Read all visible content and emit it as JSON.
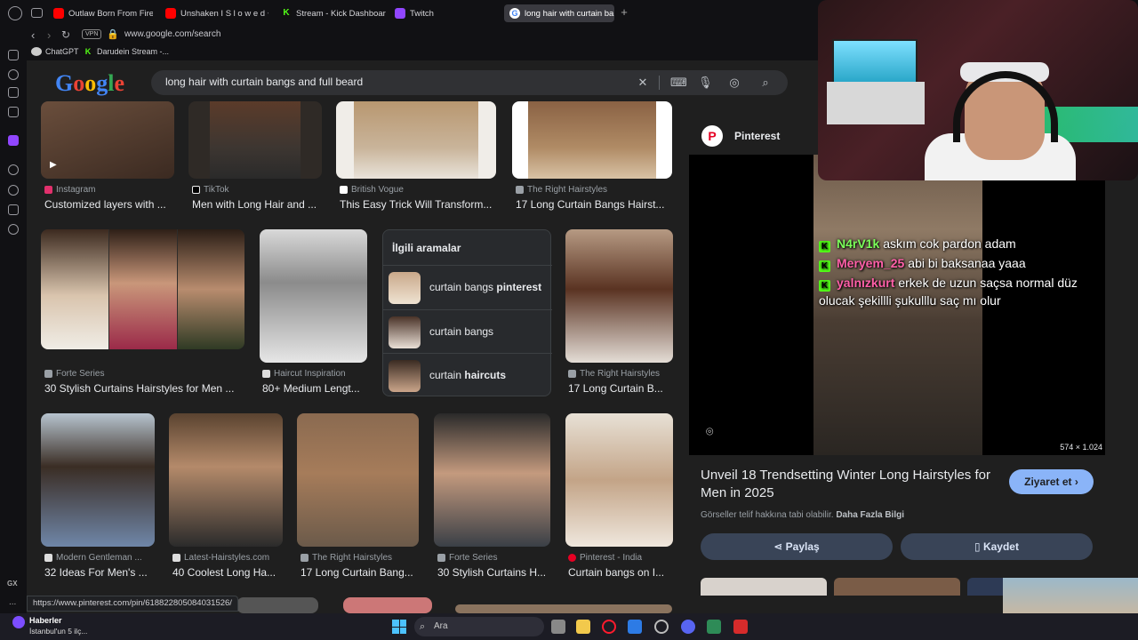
{
  "browser": {
    "tabs": [
      {
        "label": "Outlaw Born From Fire",
        "icon": "youtube-icon"
      },
      {
        "label": "Unshaken I S l o w e d + R",
        "icon": "youtube-icon"
      },
      {
        "label": "Stream - Kick Dashboard",
        "icon": "kick-icon"
      },
      {
        "label": "Twitch",
        "icon": "twitch-icon"
      },
      {
        "label": "long hair with curtain bang",
        "icon": "google-icon"
      }
    ],
    "url": "www.google.com/search",
    "vpn_label": "VPN",
    "bookmarks": [
      "ChatGPT",
      "Darudein Stream -..."
    ]
  },
  "search": {
    "query": "long hair with curtain bangs and full beard",
    "logo_letters": [
      "G",
      "o",
      "o",
      "g",
      "l",
      "e"
    ]
  },
  "results_row1": [
    {
      "source": "Instagram",
      "title": "Customized layers with ..."
    },
    {
      "source": "TikTok",
      "title": "Men with Long Hair and ..."
    },
    {
      "source": "British Vogue",
      "title": "This Easy Trick Will Transform..."
    },
    {
      "source": "The Right Hairstyles",
      "title": "17 Long Curtain Bangs Hairst..."
    }
  ],
  "results_row2": [
    {
      "source": "Forte Series",
      "title": "30 Stylish Curtains Hairstyles for Men ..."
    },
    {
      "source": "Haircut Inspiration",
      "title": "80+ Medium Lengt..."
    },
    {
      "source": "The Right Hairstyles",
      "title": "17 Long Curtain B..."
    }
  ],
  "related": {
    "heading": "İlgili aramalar",
    "items": [
      {
        "plain": "curtain bangs ",
        "bold": "pinterest"
      },
      {
        "plain": "curtain bangs",
        "bold": ""
      },
      {
        "plain": "curtain ",
        "bold": "haircuts"
      }
    ]
  },
  "results_row3": [
    {
      "source": "Modern Gentleman ...",
      "title": "32 Ideas For Men's ..."
    },
    {
      "source": "Latest-Hairstyles.com",
      "title": "40 Coolest Long Ha..."
    },
    {
      "source": "The Right Hairstyles",
      "title": "17 Long Curtain Bang..."
    },
    {
      "source": "Forte Series",
      "title": "30 Stylish Curtains H..."
    },
    {
      "source": "Pinterest - India",
      "title": "Curtain bangs on I..."
    }
  ],
  "panel": {
    "site": "Pinterest",
    "dimensions": "574 × 1.024",
    "title": "Unveil 18 Trendsetting Winter Long Hairstyles for Men in 2025",
    "visit_label": "Ziyaret et",
    "visit_arrow": "›",
    "copyright": "Görseller telif hakkına tabi olabilir.",
    "more_info": "Daha Fazla Bilgi",
    "share_label": "Paylaş",
    "save_label": "Kaydet"
  },
  "chat": [
    {
      "user": "N4rV1k",
      "text": "askım cok pardon adam",
      "color": "#7cff5a"
    },
    {
      "user": "Meryem_25",
      "text": "abi bi baksanaa yaaa",
      "color": "#ff5fa8"
    },
    {
      "user": "yalnızkurt",
      "text": "erkek de uzun saçsa normal düz olucak şekillli şukulllu saç mı olur",
      "color": "#ff5fa8"
    }
  ],
  "status_url": "https://www.pinterest.com/pin/618822805084031526/",
  "taskbar": {
    "news_title": "Haberler",
    "news_sub": "İstanbul'un 5 ilç...",
    "search_placeholder": "Ara"
  },
  "sidebar": {
    "gx_label": "GX",
    "more_label": "..."
  },
  "colors": {
    "accent": "#8ab4f8",
    "kick": "#53fc18",
    "twitch": "#9146ff",
    "pinterest": "#e60023"
  }
}
